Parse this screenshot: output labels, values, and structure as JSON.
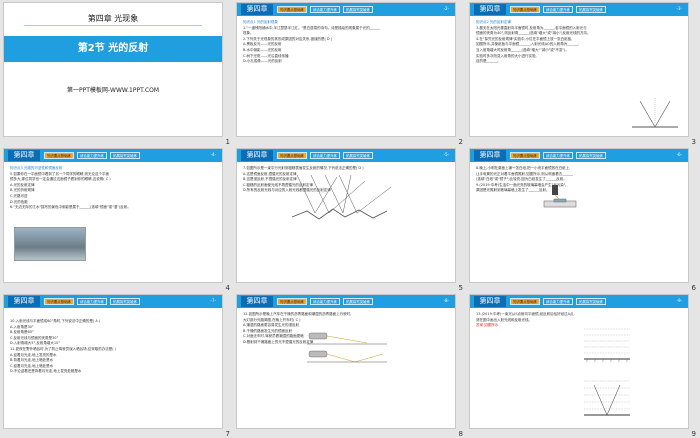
{
  "slides": [
    {
      "num": "1",
      "chapter": "第四章  光现象",
      "section": "第2节    光的反射",
      "website": "第一PPT模板网-WWW.1PPT.COM"
    },
    {
      "num": "2",
      "bar": {
        "chapter": "第四章",
        "tab1": "知识要点基础练",
        "tab2": "综合能力提升练",
        "tab3": "拓展探究突破练",
        "page": "-2-"
      },
      "lines": [
        "知识点1   光的反射现象",
        "1.\"一道残阳铺水中,半江瑟瑟半江红。\"是白居易的诗句。诗是描绘的现象属于光的______",
        "现象。",
        "2.下列关于光现象的其形成原因的对应关系,错误的是(    D    )",
        "A.黑板反光——光的反射",
        "B.水中倒影——光的反射",
        "C.树下光斑——光沿直线传播",
        "D.小孔成像——光的反射"
      ]
    },
    {
      "num": "3",
      "bar": {
        "chapter": "第四章",
        "tab1": "知识要点基础练",
        "tab2": "综合能力提升练",
        "tab3": "拓展探究突破练",
        "page": "-3-"
      },
      "lines": [
        "知识点2   光的反射定律",
        "3.晨天在太阳光垂直射向平面镜时,反射角为______,若平面镜的入射光与",
        "镜面的夹角为40°,则反射角______(选填\"增大\"或\"减小\")反射光线的方向。",
        "4.在\"探究光的反射规律\"实验中,小红在平面镜上放一张白纸板,",
        "如图所示,并使纸板与平面镜______,入射光线AO的入射角为______,",
        "当入射角增大时反射角______(选填\"增大\"\"减小\"或\"不变\")。",
        "实验时多次改变入射角的大小进行实验,",
        "目的是______。"
      ]
    },
    {
      "num": "4",
      "bar": {
        "chapter": "第四章",
        "tab1": "知识要点基础练",
        "tab2": "综合能力提升练",
        "tab3": "拓展探究突破练",
        "page": "-4-"
      },
      "lines": [
        "知识点3   光路的可逆性和镜面反射",
        "5.如果你在一平面镜中看到了另一个同学的眼睛,则无论这个平面",
        "镜多大,那位同学也一定会通过这面镜子看到你的眼睛,这说明(   C   )",
        "A.光的反射定律",
        "B.光的折射规律",
        "C.光路可逆",
        "D.光的色散",
        "6.\"无边无际的江水\"描写的景色中倒影是属于______(选填\"镜面\"或\"漫\")反射。"
      ]
    },
    {
      "num": "5",
      "bar": {
        "chapter": "第四章",
        "tab1": "知识要点基础练",
        "tab2": "综合能力提升练",
        "tab3": "拓展探究突破练",
        "page": "-5-"
      },
      "lines": [
        "7.如图所示是一束平行光射到粗糙表面发生反射的情况,下列说法正确的是(    D    )",
        "",
        "",
        "",
        "",
        "",
        "",
        "",
        "",
        "",
        "A.这是镜面反射,遵循光的反射定律",
        "B.这是漫反射,不遵循光的反射定律",
        "C.粗糙的反射面使光线不再遵循光的反射定律",
        "D.所有的反射光线与对应的入射光线都遵循光的反射定律"
      ]
    },
    {
      "num": "6",
      "bar": {
        "chapter": "第四章",
        "tab1": "知识要点基础练",
        "tab2": "综合能力提升练",
        "tab3": "拓展探究突破练",
        "page": "-6-"
      },
      "lines": [
        "8.晚上,小明在桌面上铺一张白纸,把一小块平面镜放在白纸上,",
        "让手电筒的光正对着平面镜照射,如图所示,则从侧面看去______",
        "(选填\"白纸\"或\"镜子\")比较亮,因为白纸发生了______反射。",
        "",
        "",
        "",
        "",
        "9.(2019·中考)生活中一面光亮的玻璃幕墙会产生\"光污染\",",
        "原因是光照射到玻璃幕墙上发生了______反射。"
      ]
    },
    {
      "num": "7",
      "bar": {
        "chapter": "第四章",
        "tab1": "知识要点基础练",
        "tab2": "综合能力提升练",
        "tab3": "拓展探究突破练",
        "page": "-7-"
      },
      "lines": [
        "10.入射光线与平面镜成60°角时,下列说法中正确的是(    A    )",
        "A.入射角是30°",
        "B.反射角是60°",
        "C.反射光线与镜面的夹角是30°",
        "D.入射角增大5°,反射角增大10°",
        "11.夏夜在野外晒谷时,为了防止驾驶员误入晒谷场,应采取的办法是(   )",
        "A.迎着月光走,地上发亮的是水",
        "B.背着月光走,地上暗处是水",
        "C.迎着月光走,地上暗处是水",
        "D.不论迎着还是背着月光走,地上发亮处都是水"
      ]
    },
    {
      "num": "8",
      "bar": {
        "chapter": "第四章",
        "tab1": "知识要点基础练",
        "tab2": "综合能力提升练",
        "tab3": "拓展探究突破练",
        "page": "-8-"
      },
      "lines": [
        "12.如图所示是晚上汽车在干燥的沥青路面和潮湿的沥青路面上行驶时,",
        "大灯部分光路简图,在晚上开车时(   C   )",
        "",
        "",
        "",
        "",
        "",
        "",
        "A.潮湿的路面更容易发生光的漫反射",
        "B.干燥的路面发生光的镜面反射",
        "C.对面无车时,驾驶员看潮湿的路面更暗",
        "D.照射到干燥路面上的光不遵循光的反射定律"
      ]
    },
    {
      "num": "9",
      "bar": {
        "chapter": "第四章",
        "tab1": "知识要点基础练",
        "tab2": "综合能力提升练",
        "tab3": "拓展探究突破练",
        "page": "-9-"
      },
      "lines": [
        "13.(2019·中考)一束光从S点射向平面镜,经反射后恰好经过A点,",
        "请在图中画出入射光线和反射光线。",
        "",
        "",
        "",
        "",
        "答案  如图所示"
      ]
    }
  ]
}
